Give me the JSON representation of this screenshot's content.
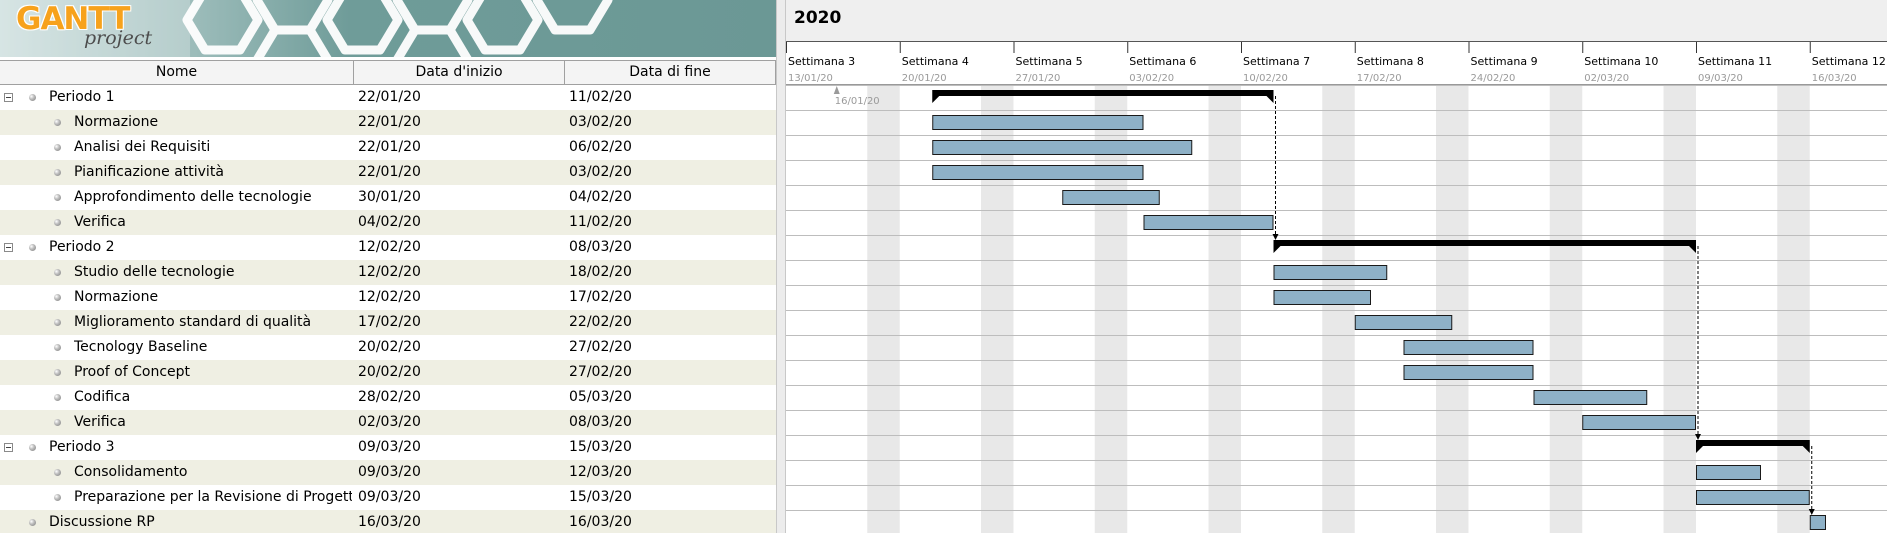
{
  "app": {
    "logo_main": "GANTT",
    "logo_sub": "project"
  },
  "table": {
    "columns": [
      "Nome",
      "Data d'inizio",
      "Data di fine"
    ],
    "rows": [
      {
        "name": "Periodo 1",
        "start": "22/01/20",
        "end": "11/02/20",
        "level": 0,
        "group": true
      },
      {
        "name": "Normazione",
        "start": "22/01/20",
        "end": "03/02/20",
        "level": 1,
        "group": false
      },
      {
        "name": "Analisi dei Requisiti",
        "start": "22/01/20",
        "end": "06/02/20",
        "level": 1,
        "group": false
      },
      {
        "name": "Pianificazione attività",
        "start": "22/01/20",
        "end": "03/02/20",
        "level": 1,
        "group": false
      },
      {
        "name": "Approfondimento delle tecnologie",
        "start": "30/01/20",
        "end": "04/02/20",
        "level": 1,
        "group": false
      },
      {
        "name": "Verifica",
        "start": "04/02/20",
        "end": "11/02/20",
        "level": 1,
        "group": false
      },
      {
        "name": "Periodo 2",
        "start": "12/02/20",
        "end": "08/03/20",
        "level": 0,
        "group": true
      },
      {
        "name": "Studio delle tecnologie",
        "start": "12/02/20",
        "end": "18/02/20",
        "level": 1,
        "group": false
      },
      {
        "name": "Normazione",
        "start": "12/02/20",
        "end": "17/02/20",
        "level": 1,
        "group": false
      },
      {
        "name": "Miglioramento standard di qualità",
        "start": "17/02/20",
        "end": "22/02/20",
        "level": 1,
        "group": false
      },
      {
        "name": "Tecnology Baseline",
        "start": "20/02/20",
        "end": "27/02/20",
        "level": 1,
        "group": false
      },
      {
        "name": "Proof of Concept",
        "start": "20/02/20",
        "end": "27/02/20",
        "level": 1,
        "group": false
      },
      {
        "name": "Codifica",
        "start": "28/02/20",
        "end": "05/03/20",
        "level": 1,
        "group": false
      },
      {
        "name": "Verifica",
        "start": "02/03/20",
        "end": "08/03/20",
        "level": 1,
        "group": false
      },
      {
        "name": "Periodo 3",
        "start": "09/03/20",
        "end": "15/03/20",
        "level": 0,
        "group": true
      },
      {
        "name": "Consolidamento",
        "start": "09/03/20",
        "end": "12/03/20",
        "level": 1,
        "group": false
      },
      {
        "name": "Preparazione per la Revisione di Progetta.",
        "start": "09/03/20",
        "end": "15/03/20",
        "level": 1,
        "group": false
      },
      {
        "name": "Discussione RP",
        "start": "16/03/20",
        "end": "16/03/20",
        "level": 0,
        "group": false,
        "no_toggle": true
      }
    ]
  },
  "gantt": {
    "year": "2020",
    "weeks": [
      {
        "label": "Settimana 3",
        "date": "13/01/20"
      },
      {
        "label": "Settimana 4",
        "date": "20/01/20"
      },
      {
        "label": "Settimana 5",
        "date": "27/01/20"
      },
      {
        "label": "Settimana 6",
        "date": "03/02/20"
      },
      {
        "label": "Settimana 7",
        "date": "10/02/20"
      },
      {
        "label": "Settimana 8",
        "date": "17/02/20"
      },
      {
        "label": "Settimana 9",
        "date": "24/02/20"
      },
      {
        "label": "Settimana 10",
        "date": "02/03/20"
      },
      {
        "label": "Settimana 11",
        "date": "09/03/20"
      },
      {
        "label": "Settimana 12",
        "date": "16/03/20"
      }
    ],
    "today_marker": "16/01/20",
    "colors": {
      "bar_fill": "#8eb1c7",
      "bar_border": "#1a1a1a",
      "summary": "#000000",
      "weekend": "#e8e8e8",
      "row_line": "#bdbdbd",
      "alt_row": "#efefe3"
    },
    "tasks": [
      {
        "row": 0,
        "start": "2020-01-22",
        "end": "2020-02-11",
        "type": "summary"
      },
      {
        "row": 1,
        "start": "2020-01-22",
        "end": "2020-02-03",
        "type": "task"
      },
      {
        "row": 2,
        "start": "2020-01-22",
        "end": "2020-02-06",
        "type": "task"
      },
      {
        "row": 3,
        "start": "2020-01-22",
        "end": "2020-02-03",
        "type": "task"
      },
      {
        "row": 4,
        "start": "2020-01-30",
        "end": "2020-02-04",
        "type": "task"
      },
      {
        "row": 5,
        "start": "2020-02-04",
        "end": "2020-02-11",
        "type": "task"
      },
      {
        "row": 6,
        "start": "2020-02-12",
        "end": "2020-03-08",
        "type": "summary"
      },
      {
        "row": 7,
        "start": "2020-02-12",
        "end": "2020-02-18",
        "type": "task"
      },
      {
        "row": 8,
        "start": "2020-02-12",
        "end": "2020-02-17",
        "type": "task"
      },
      {
        "row": 9,
        "start": "2020-02-17",
        "end": "2020-02-22",
        "type": "task"
      },
      {
        "row": 10,
        "start": "2020-02-20",
        "end": "2020-02-27",
        "type": "task"
      },
      {
        "row": 11,
        "start": "2020-02-20",
        "end": "2020-02-27",
        "type": "task"
      },
      {
        "row": 12,
        "start": "2020-02-28",
        "end": "2020-03-05",
        "type": "task"
      },
      {
        "row": 13,
        "start": "2020-03-02",
        "end": "2020-03-08",
        "type": "task"
      },
      {
        "row": 14,
        "start": "2020-03-09",
        "end": "2020-03-15",
        "type": "summary"
      },
      {
        "row": 15,
        "start": "2020-03-09",
        "end": "2020-03-12",
        "type": "task"
      },
      {
        "row": 16,
        "start": "2020-03-09",
        "end": "2020-03-15",
        "type": "task"
      },
      {
        "row": 17,
        "start": "2020-03-16",
        "end": "2020-03-16",
        "type": "task"
      }
    ],
    "dependencies": [
      {
        "from": 0,
        "to": 6
      },
      {
        "from": 6,
        "to": 14
      },
      {
        "from": 14,
        "to": 17
      }
    ]
  }
}
